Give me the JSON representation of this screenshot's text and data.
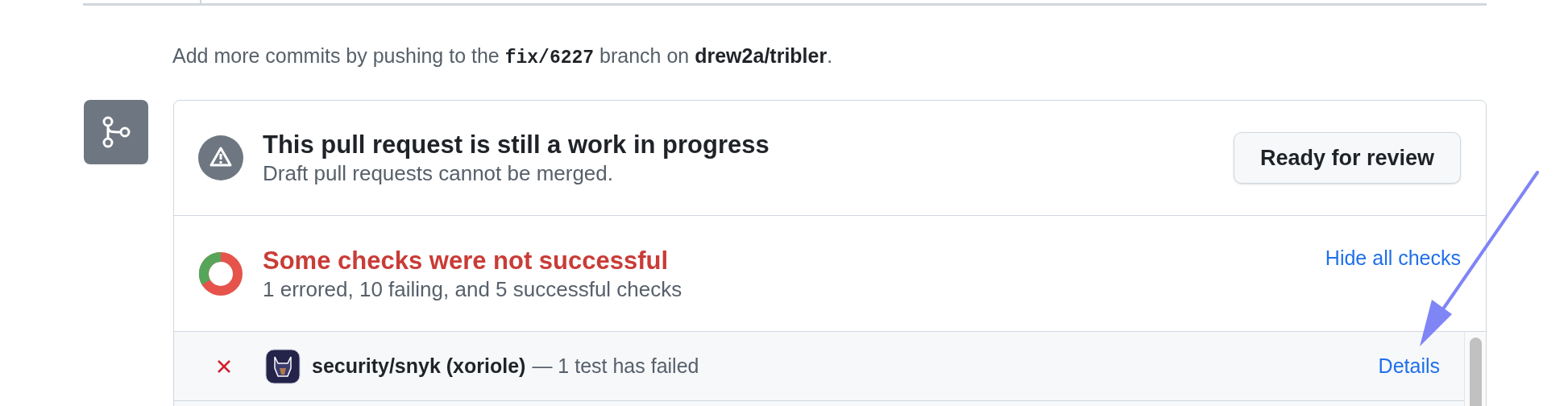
{
  "commit_hint": [
    {
      "kind": "text",
      "text": "Add more commits by pushing to the "
    },
    {
      "kind": "code",
      "text": "fix/6227"
    },
    {
      "kind": "text",
      "text": " branch on "
    },
    {
      "kind": "bold",
      "text": "drew2a/tribler"
    },
    {
      "kind": "text",
      "text": "."
    }
  ],
  "draft_notice": {
    "title": "This pull request is still a work in progress",
    "subtitle": "Draft pull requests cannot be merged.",
    "button": "Ready for review"
  },
  "checks_summary": {
    "title": "Some checks were not successful",
    "subtitle": "1 errored, 10 failing, and 5 successful checks",
    "toggle_link": "Hide all checks"
  },
  "checks": [
    {
      "failed": true,
      "name": "security/snyk (xoriole)",
      "description": "— 1 test has failed",
      "link": "Details"
    }
  ]
}
